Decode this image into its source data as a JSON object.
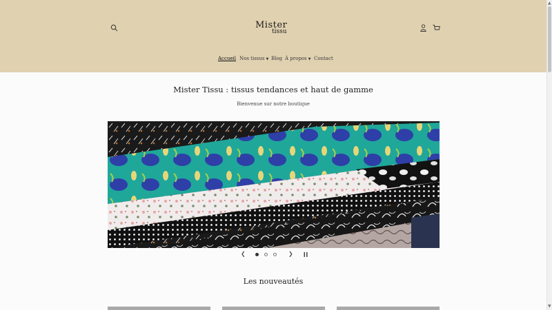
{
  "header": {
    "logo_main": "Mister",
    "logo_sub": "tissu",
    "icons": [
      "search-icon",
      "account-icon",
      "cart-icon"
    ],
    "bg_color": "#e0d1b0"
  },
  "nav": [
    {
      "label": "Accueil",
      "active": true
    },
    {
      "label": "Nos tissus",
      "dropdown": true
    },
    {
      "label": "Blog"
    },
    {
      "label": "À propos",
      "dropdown": true
    },
    {
      "label": "Contact"
    }
  ],
  "hero": {
    "title": "Mister Tissu : tissus tendances et haut de gamme",
    "subtitle": "Bienvenue sur notre boutique"
  },
  "slideshow": {
    "prev_icon": "chevron-left-icon",
    "next_icon": "chevron-right-icon",
    "pause_icon": "pause-icon",
    "slide_count": 3,
    "active_slide": 1
  },
  "section": {
    "title": "Les nouveautés"
  }
}
